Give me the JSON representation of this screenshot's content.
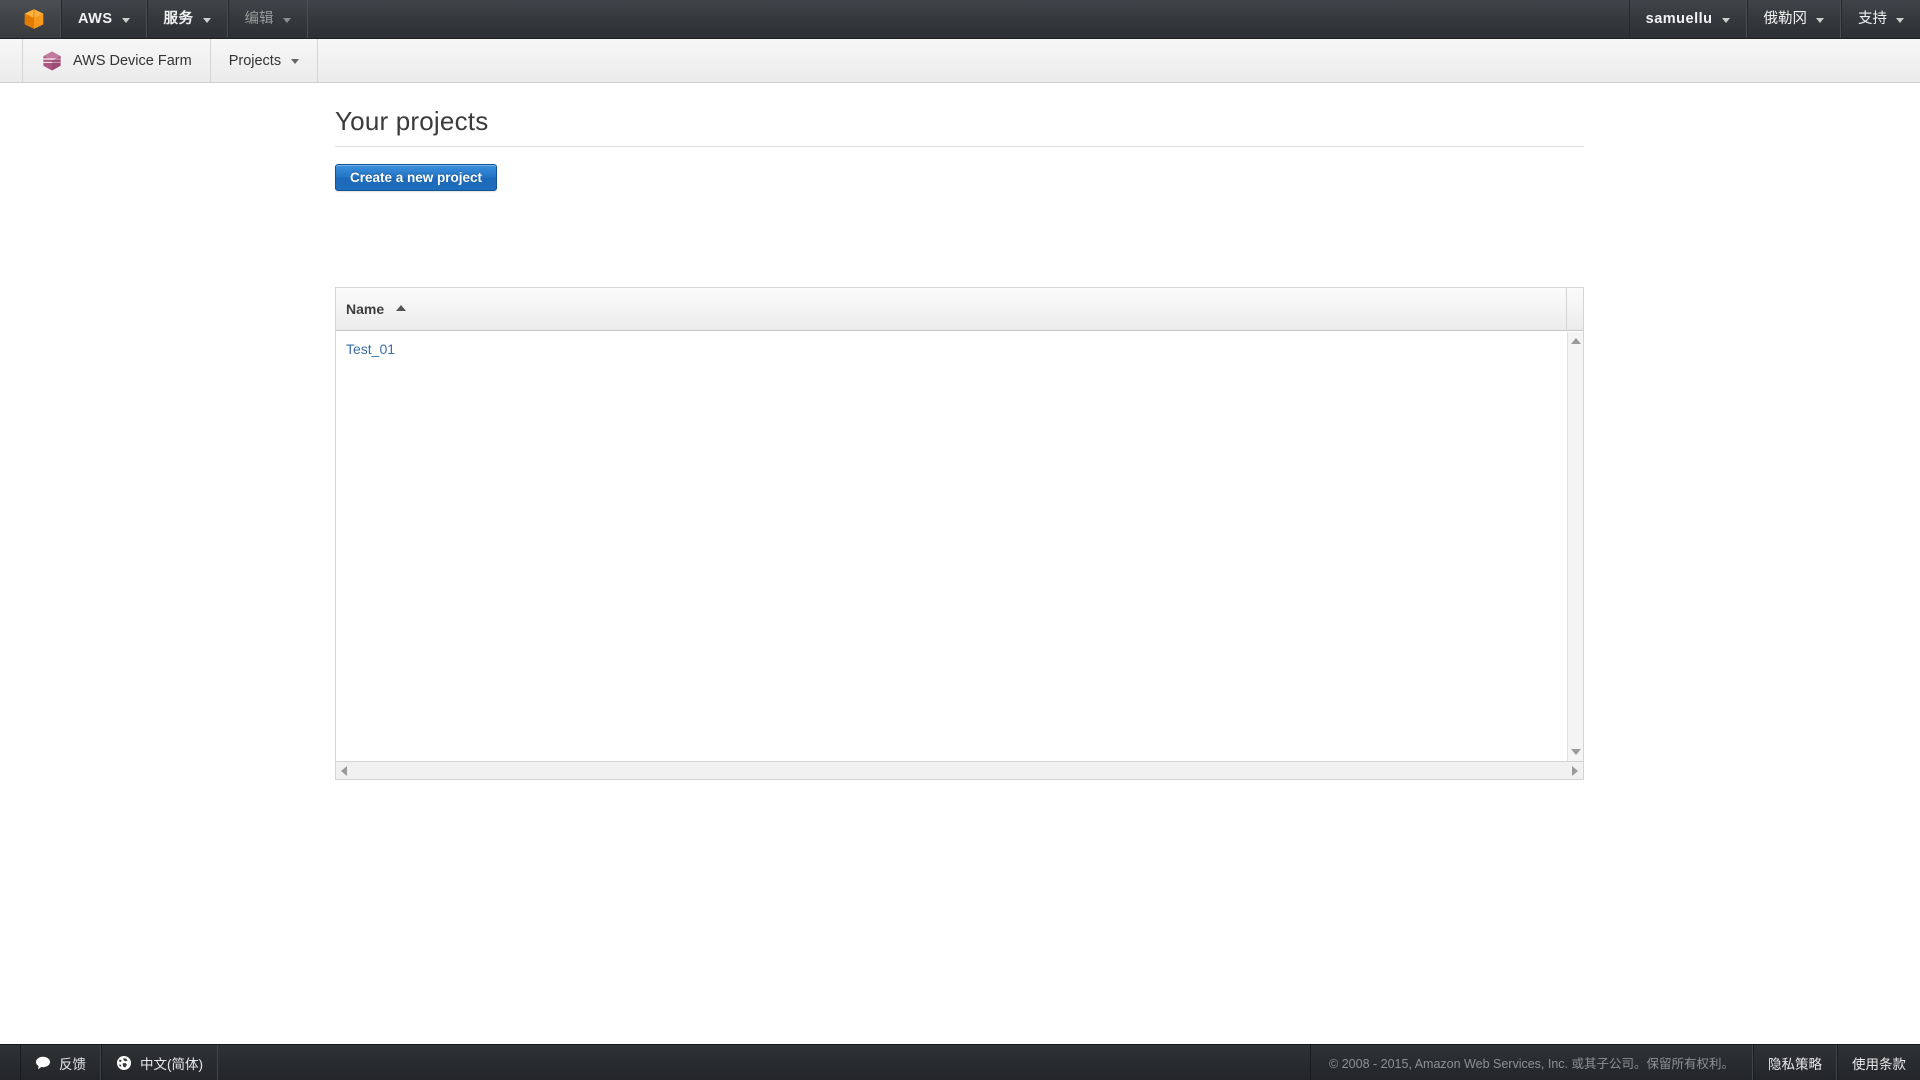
{
  "topnav": {
    "logo_icon": "aws-cube-icon",
    "items": [
      {
        "label": "AWS",
        "icon": "chevron-down-icon",
        "dim": false,
        "bold": true
      },
      {
        "label": "服务",
        "icon": "chevron-down-icon",
        "dim": false,
        "bold": true
      },
      {
        "label": "编辑",
        "icon": "chevron-down-icon",
        "dim": true,
        "bold": false
      }
    ],
    "account": [
      {
        "label": "samuellu",
        "icon": "chevron-down-icon"
      },
      {
        "label": "俄勒冈",
        "icon": "chevron-down-icon"
      },
      {
        "label": "支持",
        "icon": "chevron-down-icon"
      }
    ]
  },
  "servicebar": {
    "service_icon": "device-farm-icon",
    "service_name": "AWS Device Farm",
    "nav_label": "Projects",
    "nav_icon": "chevron-down-icon"
  },
  "main": {
    "page_title": "Your projects",
    "create_button": "Create a new project",
    "table": {
      "columns": [
        {
          "label": "Name",
          "sort": "asc",
          "sort_icon": "sort-ascending-icon"
        }
      ],
      "rows": [
        {
          "name": "Test_01"
        }
      ]
    }
  },
  "footer": {
    "feedback_icon": "speech-bubble-icon",
    "feedback_label": "反馈",
    "language_icon": "globe-icon",
    "language_label": "中文(简体)",
    "copyright": "© 2008 - 2015, Amazon Web Services, Inc. 或其子公司。保留所有权利。",
    "privacy_label": "隐私策略",
    "terms_label": "使用条款"
  },
  "colors": {
    "accent_blue": "#2274c4",
    "link_blue": "#3b6ea5",
    "aws_orange": "#f08c00",
    "device_farm_purple": "#9b4f78",
    "topnav_dark": "#35383c"
  }
}
